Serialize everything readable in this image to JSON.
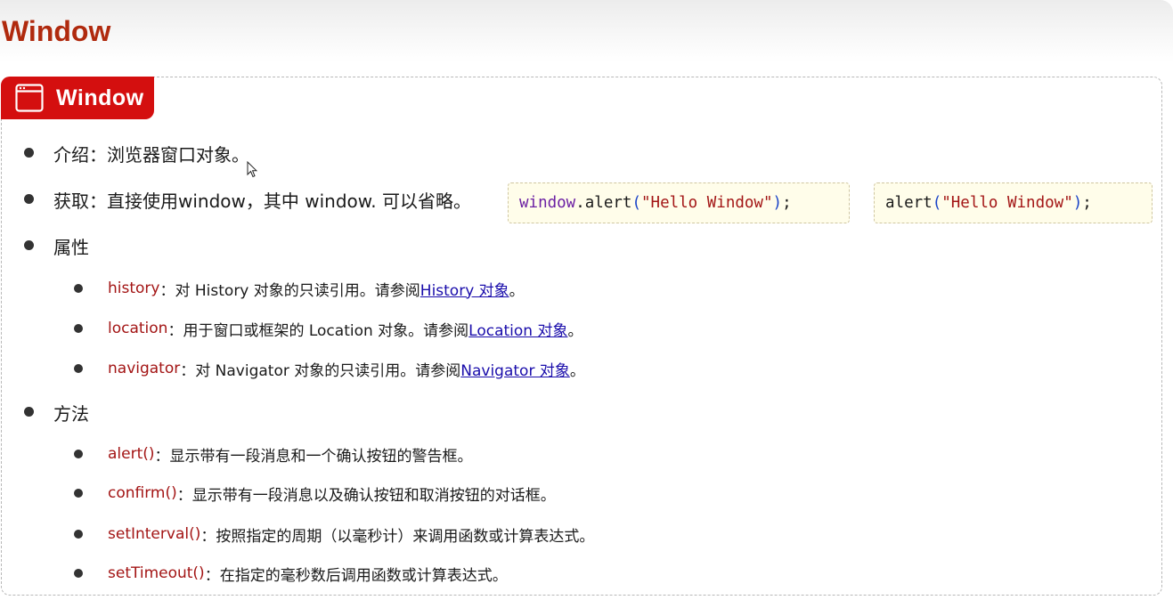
{
  "page": {
    "title": "Window"
  },
  "panel": {
    "header_label": "Window"
  },
  "intro": {
    "label": "介绍：",
    "text": "浏览器窗口对象。"
  },
  "access": {
    "label": "获取：",
    "text": "直接使用window，其中 window. 可以省略。"
  },
  "code_examples": [
    {
      "obj": "window",
      "dot": ".",
      "method": "alert",
      "open": "(",
      "str": "\"Hello Window\"",
      "close": ")",
      "semi": ";"
    },
    {
      "method": "alert",
      "open": "(",
      "str": "\"Hello Window\"",
      "close": ")",
      "semi": ";"
    }
  ],
  "properties": {
    "heading": "属性",
    "items": [
      {
        "name": "history",
        "sep": "：",
        "desc": "对 History 对象的只读引用。请参阅 ",
        "link": "History 对象",
        "end": "。"
      },
      {
        "name": "location",
        "sep": "：",
        "desc": "用于窗口或框架的 Location 对象。请参阅 ",
        "link": "Location 对象",
        "end": "。"
      },
      {
        "name": "navigator",
        "sep": "：",
        "desc": "对 Navigator 对象的只读引用。请参阅 ",
        "link": "Navigator 对象",
        "end": "。"
      }
    ]
  },
  "methods": {
    "heading": "方法",
    "items": [
      {
        "name": "alert()",
        "sep": "：",
        "desc": "显示带有一段消息和一个确认按钮的警告框。"
      },
      {
        "name": "confirm()",
        "sep": "：",
        "desc": "显示带有一段消息以及确认按钮和取消按钮的对话框。"
      },
      {
        "name": "setInterval()",
        "sep": "：",
        "desc": "按照指定的周期（以毫秒计）来调用函数或计算表达式。"
      },
      {
        "name": "setTimeout()",
        "sep": "：",
        "desc": "在指定的毫秒数后调用函数或计算表达式。"
      }
    ]
  },
  "colors": {
    "title": "#b02a0e",
    "header_bg": "#d40f0f",
    "keyword": "#a31515",
    "link": "#1a0dab",
    "code_bg": "#fffdea"
  },
  "icons": {
    "header": "window-icon",
    "pointer": "mouse-pointer-icon"
  }
}
